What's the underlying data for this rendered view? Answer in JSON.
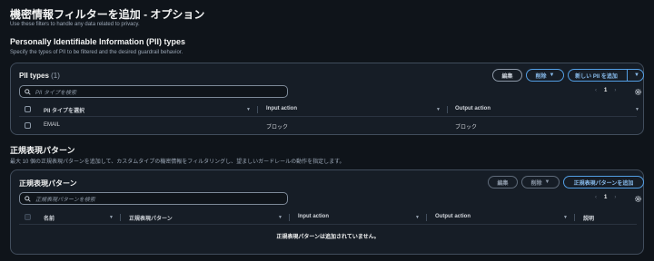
{
  "page": {
    "title": "機密情報フィルターを追加 - オプション",
    "subtitle": "Use these filters to handle any data related to privacy."
  },
  "pii_section": {
    "heading": "Personally Identifiable Information (PII) types",
    "description": "Specify the types of PII to be filtered and the desired guardrail behavior."
  },
  "pii_panel": {
    "title": "PII types",
    "count": "(1)",
    "edit_label": "編集",
    "delete_label": "削除",
    "add_label": "新しい PII を追加",
    "search_placeholder": "PII タイプを検索",
    "page_number": "1",
    "columns": [
      "PII タイプを選択",
      "Input action",
      "Output action"
    ],
    "rows": [
      {
        "type": "EMAIL",
        "input_action": "ブロック",
        "output_action": "ブロック"
      }
    ]
  },
  "regex_section": {
    "heading": "正規表現パターン",
    "description": "最大 10 個の正規表現パターンを追加して、カスタムタイプの機密情報をフィルタリングし、望ましいガードレールの動作を指定します。"
  },
  "regex_panel": {
    "title": "正規表現パターン",
    "edit_label": "編集",
    "delete_label": "削除",
    "add_label": "正規表現パターンを追加",
    "search_placeholder": "正規表現パターンを検索",
    "page_number": "1",
    "columns": [
      "名前",
      "正規表現パターン",
      "Input action",
      "Output action",
      "説明"
    ],
    "empty_message": "正規表現パターンは追加されていません。"
  },
  "colors": {
    "background": "#0f141a",
    "panel": "#161d26",
    "accent": "#539fe5"
  }
}
